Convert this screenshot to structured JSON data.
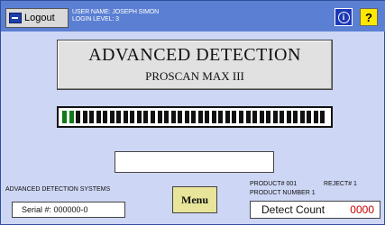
{
  "header": {
    "logout_label": "Logout",
    "user_name": "USER NAME: JOSEPH SIMON",
    "login_level": "LOGIN LEVEL: 3",
    "info_icon": "info-icon",
    "help_label": "?"
  },
  "title": {
    "main": "ADVANCED DETECTION",
    "sub": "PROSCAN MAX III"
  },
  "signal_meter": {
    "segments": 39,
    "active_segments": 2,
    "active_color": "#117a17",
    "inactive_color": "#111111"
  },
  "readout": {
    "value": ""
  },
  "footer": {
    "company": "ADVANCED DETECTION SYSTEMS",
    "serial": "Serial #:  000000-0",
    "menu_label": "Menu",
    "product_number": "PRODUCT# 001",
    "reject": "REJECT# 1",
    "product_name": "PRODUCT NUMBER 1",
    "detect_label": "Detect Count",
    "detect_value": "0000"
  }
}
